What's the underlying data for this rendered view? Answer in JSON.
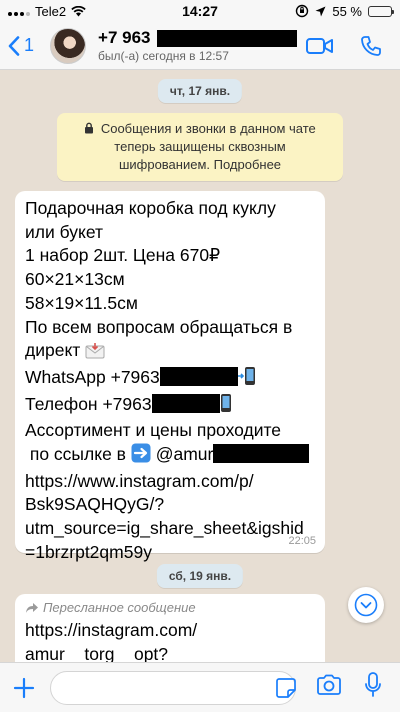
{
  "status_bar": {
    "carrier": "Tele2",
    "time": "14:27",
    "battery": "55 %",
    "battery_level": 0.55
  },
  "header": {
    "back_count": "1",
    "contact_name": "+7 963",
    "last_seen": "был(-а) сегодня в 12:57"
  },
  "chat": {
    "date_1": "чт, 17 янв.",
    "encryption_notice": "Сообщения и звонки в данном чате теперь защищены сквозным шифрованием. Подробнее",
    "message_1": {
      "lines": {
        "l1": "Подарочная коробка под куклу",
        "l2": "или букет",
        "l3": "1 набор 2шт. Цена 670₽",
        "l4": "60×21×13см",
        "l5": "58×19×11.5см",
        "l6": "По всем вопросам обращаться в",
        "l7": "директ",
        "l8": "WhatsApp +7963",
        "l9": "Телефон +7963",
        "l10": "Ассортимент и цены проходите",
        "l11": " по ссылке в",
        "l11b": "@amur",
        "l12": "https://www.instagram.com/p/",
        "l13": "Bsk9SAQHQyG/?",
        "l14": "utm_source=ig_share_sheet&igshid",
        "l15": "=1brzrpt2qm59y"
      },
      "time": "22:05"
    },
    "date_2": "сб, 19 янв.",
    "message_2": {
      "forwarded_label": "Пересланное сообщение",
      "lines": {
        "l1": "https://instagram.com/",
        "l2": "amur__torg__opt?"
      }
    }
  },
  "composer": {
    "placeholder": ""
  },
  "colors": {
    "accent": "#1a7efb",
    "chat_background": "#e7ded3",
    "bubble": "#ffffff",
    "notice": "#fbf3c4",
    "date_pill": "#dde9f0"
  },
  "icons": {
    "back": "chevron-left-icon",
    "video": "video-camera-icon",
    "call": "phone-icon",
    "lock": "lock-icon",
    "envelope": "envelope-emoji-icon",
    "phone_emoji": "mobile-phone-emoji-icon",
    "arrow_right": "right-arrow-emoji-icon",
    "forward": "forward-arrow-icon",
    "scroll": "chevron-down-icon",
    "plus": "plus-icon",
    "sticker": "sticker-icon",
    "camera": "camera-icon",
    "mic": "microphone-icon"
  }
}
